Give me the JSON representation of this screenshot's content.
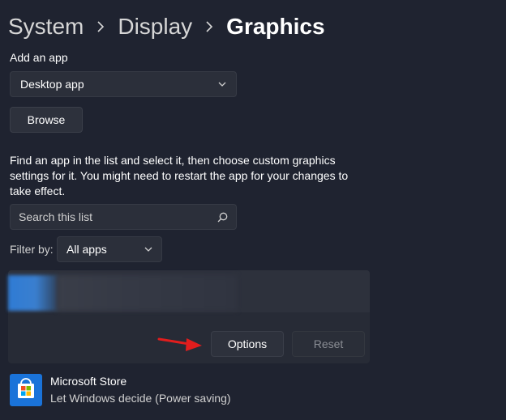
{
  "breadcrumb": {
    "items": [
      "System",
      "Display"
    ],
    "current": "Graphics"
  },
  "add_app": {
    "label": "Add an app",
    "selected": "Desktop app",
    "browse_label": "Browse"
  },
  "description": "Find an app in the list and select it, then choose custom graphics settings for it. You might need to restart the app for your changes to take effect.",
  "search": {
    "placeholder": "Search this list"
  },
  "filter": {
    "label": "Filter by:",
    "selected": "All apps"
  },
  "app_card": {
    "options_label": "Options",
    "reset_label": "Reset"
  },
  "apps": [
    {
      "name": "Microsoft Store",
      "status": "Let Windows decide (Power saving)",
      "icon": "microsoft-store-icon"
    }
  ],
  "colors": {
    "background": "#1f2330",
    "control": "#2b2f3a",
    "arrow": "#e11d1d",
    "store_blue": "#1a73d9"
  }
}
